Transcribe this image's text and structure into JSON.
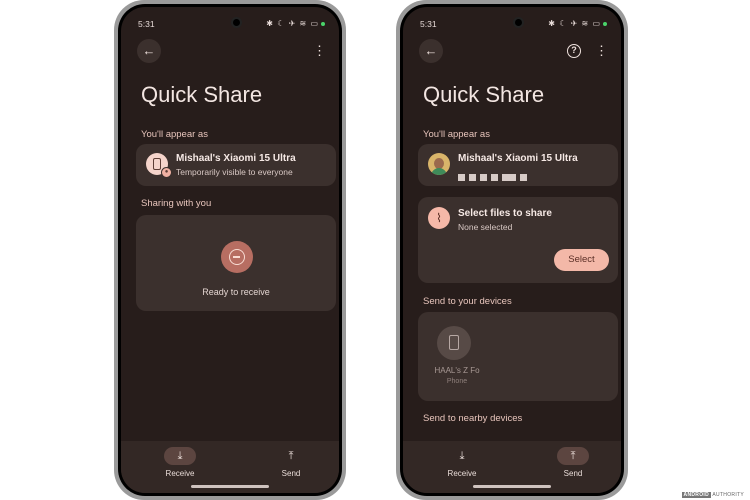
{
  "status_bar": {
    "time": "5:31",
    "icons": "✱ ☾ ✈ ≋ ▭"
  },
  "left": {
    "title": "Quick Share",
    "appear_as_label": "You'll appear as",
    "device_name": "Mishaal's Xiaomi 15 Ultra",
    "visibility": "Temporarily visible to everyone",
    "sharing_label": "Sharing with you",
    "ready_text": "Ready to receive",
    "nav": {
      "receive": "Receive",
      "send": "Send",
      "active": "Receive"
    }
  },
  "right": {
    "title": "Quick Share",
    "appear_as_label": "You'll appear as",
    "device_name": "Mishaal's Xiaomi 15 Ultra",
    "select_title": "Select files to share",
    "select_sub": "None selected",
    "select_button": "Select",
    "your_devices_label": "Send to your devices",
    "device": {
      "name": "HAAL's Z Fo",
      "type": "Phone"
    },
    "nearby_label": "Send to nearby devices",
    "nav": {
      "receive": "Receive",
      "send": "Send",
      "active": "Send"
    }
  },
  "icons": {
    "back": "arrow-left-icon",
    "menu": "more-vert-icon",
    "help": "help-icon",
    "receive": "download-icon",
    "send": "upload-icon",
    "attach": "paperclip-icon"
  },
  "colors": {
    "background": "#271d1b",
    "card": "#3b302d",
    "accent": "#f3b8a8",
    "label": "#e9c6bd"
  },
  "watermark": {
    "brand": "ANDROID",
    "text": "AUTHORITY"
  }
}
